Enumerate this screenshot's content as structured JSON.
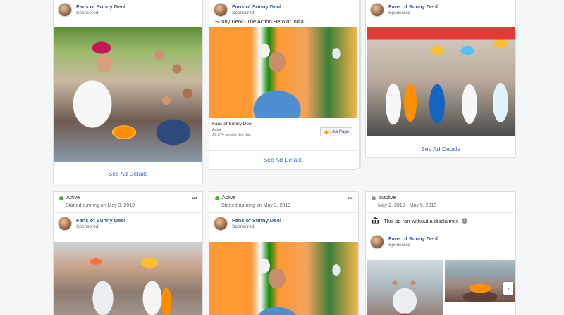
{
  "page_name": "Fans of Sunny Deol",
  "sponsored": "Sponsored",
  "see_ad_details": "See Ad Details",
  "ad2_caption": "Sunny Deol - The Action Hero of India",
  "ad2_cta": {
    "page": "Fans of Sunny Deol",
    "category": "Actor",
    "likes": "99,974 people like this",
    "like_button": "Like Page"
  },
  "bottom": [
    {
      "status": "Active",
      "status_color": "#42b72a",
      "dates": "Started running on May 3, 2019"
    },
    {
      "status": "Active",
      "status_color": "#42b72a",
      "dates": "Started running on May 3, 2019"
    },
    {
      "status": "Inactive",
      "status_color": "#8d949e",
      "dates": "May 2, 2019 - May 5, 2019"
    }
  ],
  "disclaimer": "This ad ran without a disclaimer.",
  "icons": {
    "more": "more-options-icon",
    "bank": "disclaimer-bank-icon",
    "info": "info-icon",
    "next": "chevron-right-icon"
  }
}
